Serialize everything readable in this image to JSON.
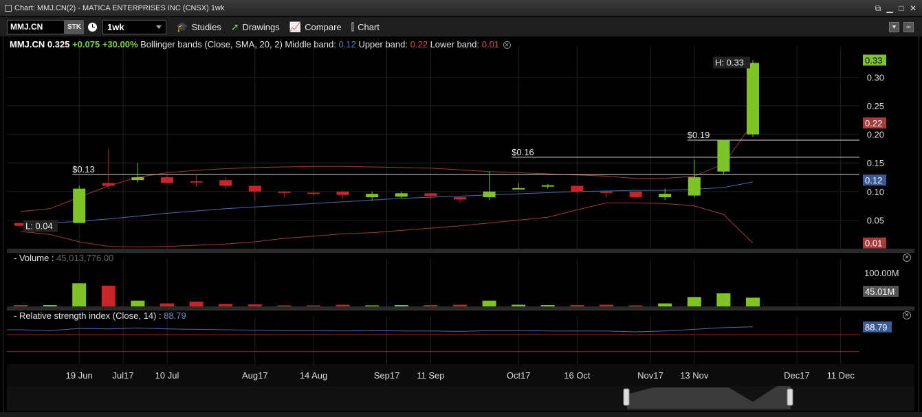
{
  "window": {
    "title": "Chart: MMJ.CN(2) - MATICA ENTERPRISES INC (CNSX) 1wk"
  },
  "toolbar": {
    "symbol": "MMJ.CN",
    "type_badge": "STK",
    "period": "1wk",
    "studies_label": "Studies",
    "drawings_label": "Drawings",
    "compare_label": "Compare",
    "chart_label": "Chart"
  },
  "header": {
    "symbol": "MMJ.CN",
    "price": "0.325",
    "change": "+0.075",
    "change_pct": "+30.00%",
    "study": "Bollinger bands (Close, SMA, 20, 2)",
    "middle_label": "Middle band:",
    "middle_value": "0.12",
    "upper_label": "Upper band:",
    "upper_value": "0.22",
    "lower_label": "Lower band:",
    "lower_value": "0.01"
  },
  "volume_panel": {
    "label": "- Volume",
    "value": "45,013,776.00"
  },
  "rsi_panel": {
    "label": "- Relative strength index (Close, 14)",
    "value": "88.79"
  },
  "colors": {
    "up": "#7ec427",
    "down": "#c9242a",
    "bb_band": "#a23a3a",
    "bb_mid": "#4d6ab0",
    "rsi": "#4d6ab0"
  },
  "chart_data": {
    "type": "candlestick",
    "price_axis": {
      "ticks": [
        "0.30",
        "0.25",
        "0.20",
        "0.15",
        "0.10",
        "0.05"
      ],
      "tick_values": [
        0.3,
        0.25,
        0.2,
        0.15,
        0.1,
        0.05
      ],
      "range": [
        0.0,
        0.345
      ]
    },
    "x_ticks": [
      {
        "label": "19 Jun",
        "index": 2
      },
      {
        "label": "Jul17",
        "index": 3.5
      },
      {
        "label": "10 Jul",
        "index": 5
      },
      {
        "label": "Aug17",
        "index": 8
      },
      {
        "label": "14 Aug",
        "index": 10
      },
      {
        "label": "Sep17",
        "index": 12.5
      },
      {
        "label": "11 Sep",
        "index": 14
      },
      {
        "label": "Oct17",
        "index": 17
      },
      {
        "label": "16 Oct",
        "index": 19
      },
      {
        "label": "Nov17",
        "index": 21.5
      },
      {
        "label": "13 Nov",
        "index": 23
      },
      {
        "label": "Dec17",
        "index": 26.5
      },
      {
        "label": "11 Dec",
        "index": 28
      }
    ],
    "candles": [
      {
        "o": 0.045,
        "h": 0.045,
        "l": 0.04,
        "c": 0.04
      },
      {
        "o": 0.04,
        "h": 0.04,
        "l": 0.04,
        "c": 0.04
      },
      {
        "o": 0.045,
        "h": 0.11,
        "l": 0.045,
        "c": 0.105
      },
      {
        "o": 0.115,
        "h": 0.175,
        "l": 0.105,
        "c": 0.11
      },
      {
        "o": 0.12,
        "h": 0.15,
        "l": 0.115,
        "c": 0.125
      },
      {
        "o": 0.125,
        "h": 0.13,
        "l": 0.115,
        "c": 0.115
      },
      {
        "o": 0.118,
        "h": 0.13,
        "l": 0.108,
        "c": 0.116
      },
      {
        "o": 0.12,
        "h": 0.125,
        "l": 0.105,
        "c": 0.11
      },
      {
        "o": 0.11,
        "h": 0.11,
        "l": 0.085,
        "c": 0.1
      },
      {
        "o": 0.1,
        "h": 0.1,
        "l": 0.09,
        "c": 0.099
      },
      {
        "o": 0.098,
        "h": 0.1,
        "l": 0.092,
        "c": 0.097
      },
      {
        "o": 0.1,
        "h": 0.1,
        "l": 0.088,
        "c": 0.094
      },
      {
        "o": 0.09,
        "h": 0.1,
        "l": 0.085,
        "c": 0.096
      },
      {
        "o": 0.091,
        "h": 0.1,
        "l": 0.089,
        "c": 0.097
      },
      {
        "o": 0.097,
        "h": 0.097,
        "l": 0.087,
        "c": 0.092
      },
      {
        "o": 0.09,
        "h": 0.09,
        "l": 0.08,
        "c": 0.086
      },
      {
        "o": 0.09,
        "h": 0.135,
        "l": 0.085,
        "c": 0.1
      },
      {
        "o": 0.105,
        "h": 0.115,
        "l": 0.105,
        "c": 0.106
      },
      {
        "o": 0.109,
        "h": 0.113,
        "l": 0.105,
        "c": 0.111
      },
      {
        "o": 0.11,
        "h": 0.11,
        "l": 0.095,
        "c": 0.1
      },
      {
        "o": 0.1,
        "h": 0.1,
        "l": 0.09,
        "c": 0.099
      },
      {
        "o": 0.1,
        "h": 0.1,
        "l": 0.088,
        "c": 0.09
      },
      {
        "o": 0.09,
        "h": 0.105,
        "l": 0.085,
        "c": 0.096
      },
      {
        "o": 0.093,
        "h": 0.156,
        "l": 0.09,
        "c": 0.125
      },
      {
        "o": 0.135,
        "h": 0.19,
        "l": 0.13,
        "c": 0.19
      },
      {
        "o": 0.2,
        "h": 0.33,
        "l": 0.195,
        "c": 0.325
      }
    ],
    "bb_upper": [
      0.065,
      0.07,
      0.09,
      0.11,
      0.125,
      0.133,
      0.137,
      0.14,
      0.142,
      0.143,
      0.144,
      0.144,
      0.143,
      0.142,
      0.141,
      0.138,
      0.135,
      0.133,
      0.131,
      0.129,
      0.127,
      0.123,
      0.123,
      0.127,
      0.148,
      0.22
    ],
    "bb_middle": [
      0.042,
      0.045,
      0.048,
      0.052,
      0.057,
      0.062,
      0.066,
      0.07,
      0.073,
      0.076,
      0.079,
      0.082,
      0.085,
      0.088,
      0.09,
      0.092,
      0.094,
      0.096,
      0.098,
      0.1,
      0.101,
      0.102,
      0.102,
      0.104,
      0.107,
      0.117
    ],
    "bb_lower": [
      0.03,
      0.025,
      0.012,
      0.004,
      0.003,
      0.004,
      0.006,
      0.008,
      0.012,
      0.018,
      0.022,
      0.026,
      0.028,
      0.032,
      0.036,
      0.04,
      0.045,
      0.05,
      0.055,
      0.068,
      0.08,
      0.08,
      0.079,
      0.075,
      0.06,
      0.01
    ],
    "h_lines": [
      {
        "value": 0.13,
        "label": "$0.13",
        "from_index": 2
      },
      {
        "value": 0.16,
        "label": "$0.16",
        "from_index": 17
      },
      {
        "value": 0.19,
        "label": "$0.19",
        "from_index": 23
      }
    ],
    "high_label": "H: 0.33",
    "low_label": "L: 0.04",
    "price_badges": [
      {
        "label": "0.33",
        "value": 0.33,
        "kind": "up"
      },
      {
        "label": "0.22",
        "value": 0.22,
        "kind": "upper"
      },
      {
        "label": "0.12",
        "value": 0.12,
        "kind": "mid"
      },
      {
        "label": "0.01",
        "value": 0.01,
        "kind": "lower"
      }
    ],
    "volume": {
      "axis_label": "100.00M",
      "axis_value": 100,
      "range": [
        0,
        125
      ],
      "badge": "45.01M",
      "badge_value": 45.01,
      "bars_m": [
        4,
        4,
        69,
        62,
        17,
        9,
        14,
        7,
        6,
        3,
        3,
        5,
        3,
        4,
        4,
        5,
        17,
        5,
        4,
        4,
        5,
        3,
        9,
        28,
        39,
        26
      ]
    },
    "rsi": {
      "range": [
        0,
        100
      ],
      "upper_line": 70,
      "lower_line": 30,
      "badge": "88.79",
      "badge_value": 88.79,
      "values": [
        82,
        80,
        85,
        84,
        86,
        84,
        83,
        82,
        81,
        80,
        80,
        79,
        80,
        79,
        79,
        78,
        80,
        80,
        79,
        79,
        79,
        77,
        79,
        83,
        87,
        88.79
      ]
    }
  }
}
